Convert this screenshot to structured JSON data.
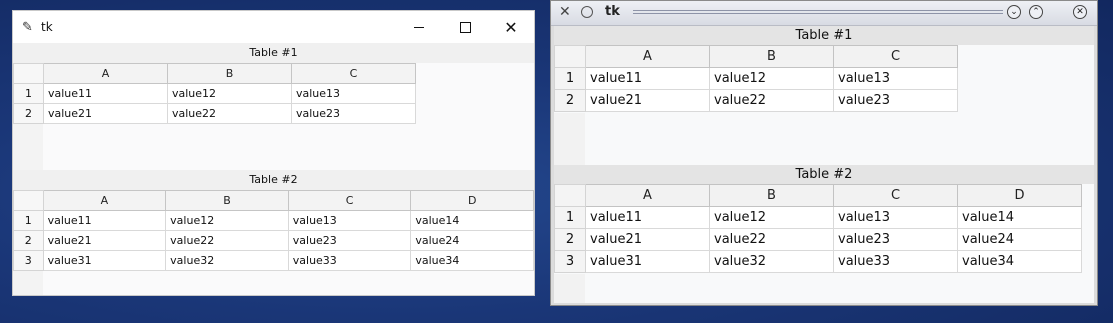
{
  "left_window": {
    "title": "tk",
    "icons": {
      "app": "feather-icon",
      "min": "minimize-icon",
      "max": "maximize-icon",
      "close": "close-icon"
    }
  },
  "right_window": {
    "title": "tk",
    "icons": {
      "menu": "window-menu-icon",
      "sticky": "circle-icon",
      "min": "chevron-down-icon",
      "max": "chevron-up-icon",
      "close": "close-icon"
    }
  },
  "table1": {
    "label": "Table #1",
    "columns": [
      "A",
      "B",
      "C"
    ],
    "rows": [
      {
        "index": "1",
        "cells": [
          "value11",
          "value12",
          "value13"
        ]
      },
      {
        "index": "2",
        "cells": [
          "value21",
          "value22",
          "value23"
        ]
      }
    ]
  },
  "table2": {
    "label": "Table #2",
    "columns": [
      "A",
      "B",
      "C",
      "D"
    ],
    "rows": [
      {
        "index": "1",
        "cells": [
          "value11",
          "value12",
          "value13",
          "value14"
        ]
      },
      {
        "index": "2",
        "cells": [
          "value21",
          "value22",
          "value23",
          "value24"
        ]
      },
      {
        "index": "3",
        "cells": [
          "value31",
          "value32",
          "value33",
          "value34"
        ]
      }
    ]
  }
}
